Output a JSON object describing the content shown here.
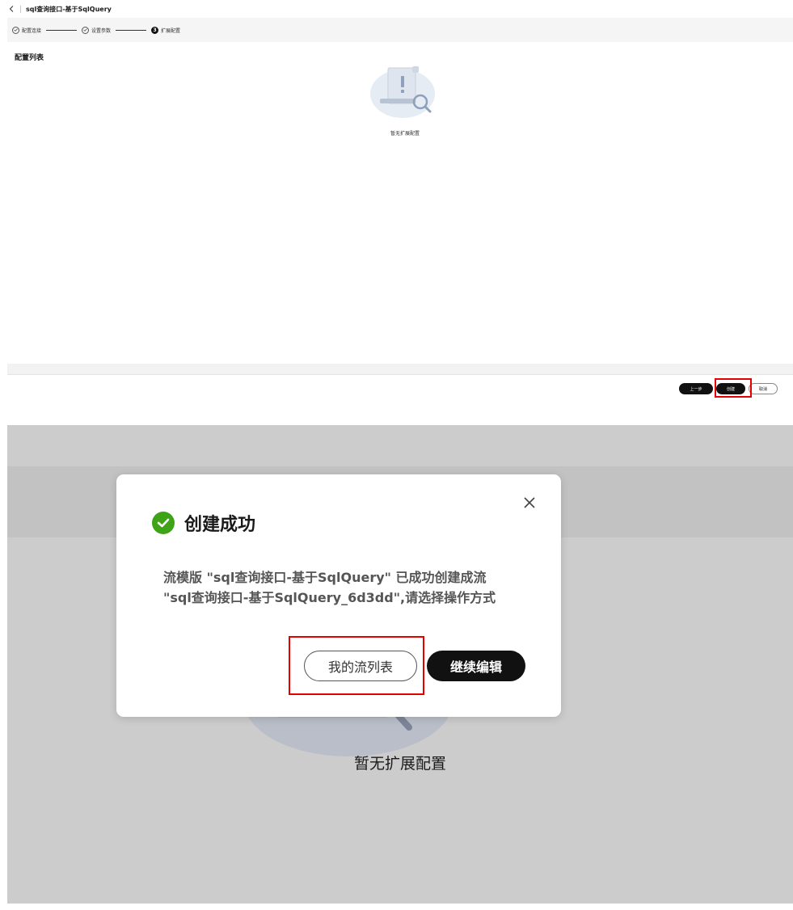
{
  "top": {
    "title": "sql查询接口-基于SqlQuery",
    "steps": [
      {
        "label": "配置连接",
        "state": "done"
      },
      {
        "label": "设置参数",
        "state": "done"
      },
      {
        "label": "扩展配置",
        "state": "active",
        "index": "3"
      }
    ],
    "section_title": "配置列表",
    "empty_text": "暂无扩展配置",
    "buttons": {
      "prev": "上一步",
      "create": "创建",
      "cancel": "取消"
    }
  },
  "modal": {
    "title": "创建成功",
    "body_line1": "流模版 \"sql查询接口-基于SqlQuery\" 已成功创建成流",
    "body_line2": "\"sql查询接口-基于SqlQuery_6d3dd\",请选择操作方式",
    "btn_list": "我的流列表",
    "btn_edit": "继续编辑"
  },
  "background": {
    "empty_text": "暂无扩展配置"
  },
  "colors": {
    "success": "#3fa318",
    "highlight": "#e60000",
    "primary_dark": "#111111",
    "overlay": "#cccccc"
  }
}
